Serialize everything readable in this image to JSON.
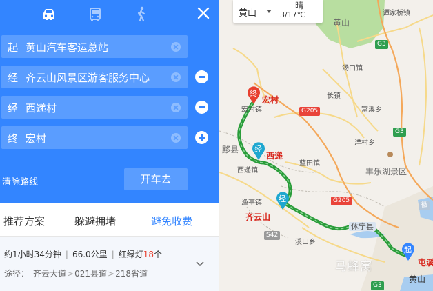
{
  "modes": {
    "car": "car-icon",
    "bus": "bus-icon",
    "walk": "walk-icon"
  },
  "close": "close-icon",
  "waypoints": [
    {
      "prefix": "起",
      "name": "黄山汽车客运总站"
    },
    {
      "prefix": "经",
      "name": "齐云山风景区游客服务中心"
    },
    {
      "prefix": "经",
      "name": "西递村"
    },
    {
      "prefix": "终",
      "name": "宏村"
    }
  ],
  "clear_route": "清除路线",
  "drive_button": "开车去",
  "tabs": [
    {
      "label": "推荐方案"
    },
    {
      "label": "躲避拥堵"
    },
    {
      "label": "避免收费"
    }
  ],
  "summary": {
    "duration": "约1小时34分钟",
    "sep": "|",
    "distance": "66.0公里",
    "lights_prefix": "红绿灯",
    "lights_count": "18",
    "lights_unit": "个",
    "via_prefix": "途径：",
    "roads": [
      "齐云大道",
      "021县道",
      "218省道"
    ],
    "gt": ">"
  },
  "map": {
    "city": "黄山",
    "weather": "晴",
    "temp": "3/17℃",
    "labels": {
      "huangshan_top": "黄山",
      "tankou": "谭家桥镇",
      "tangkou": "汤口镇",
      "changqiao": "长镇",
      "fugu": "富溪乡",
      "yangcun": "洋村乡",
      "hongcun_town": "宏村镇",
      "yixian": "黟县",
      "xidi_town": "西递镇",
      "lantian": "蓝田镇",
      "fengle": "丰乐湖景区",
      "yuting": "渔亭镇",
      "xiuning": "休宁县",
      "runshan": "溪口乡",
      "huangshan_city": "黄山"
    },
    "pins": {
      "end_label": "宏村",
      "via1_label": "西递",
      "via2_label": "齐云山",
      "start_label": "屯溪",
      "end_mark": "终",
      "via_mark": "经",
      "start_mark": "起"
    },
    "shields": {
      "g3_top": "G3",
      "g205_a": "G205",
      "g3_mid": "G3",
      "g205_b": "G205",
      "s42": "S42",
      "g3_bottom": "G3",
      "hui": "徽"
    },
    "watermark": "马蜂窝"
  }
}
